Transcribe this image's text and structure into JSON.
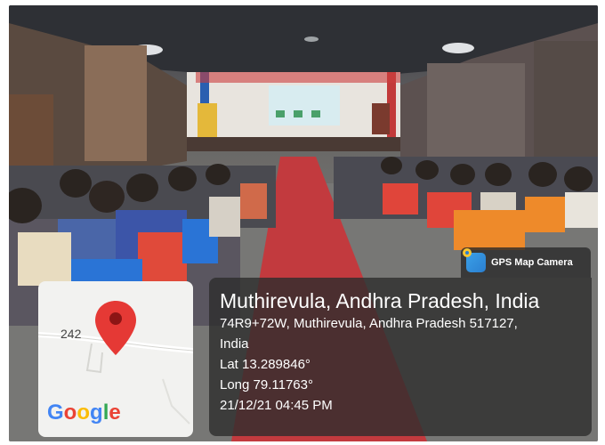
{
  "badge": {
    "app_name": "GPS Map Camera",
    "icon": "map-pin-app-icon"
  },
  "location": {
    "title": "Muthirevula, Andhra Pradesh, India",
    "address_line1": "74R9+72W, Muthirevula, Andhra Pradesh 517127,",
    "address_line2": "India",
    "lat": "Lat 13.289846°",
    "long": "Long 79.11763°",
    "datetime": "21/12/21 04:45 PM"
  },
  "map": {
    "road_number": "242",
    "marker_icon": "map-marker-icon",
    "logo_letters": [
      "G",
      "o",
      "o",
      "g",
      "l",
      "e"
    ],
    "logo_colors": [
      "#4285F4",
      "#EA4335",
      "#FBBC05",
      "#4285F4",
      "#34A853",
      "#EA4335"
    ],
    "marker_color": "#E53935"
  }
}
